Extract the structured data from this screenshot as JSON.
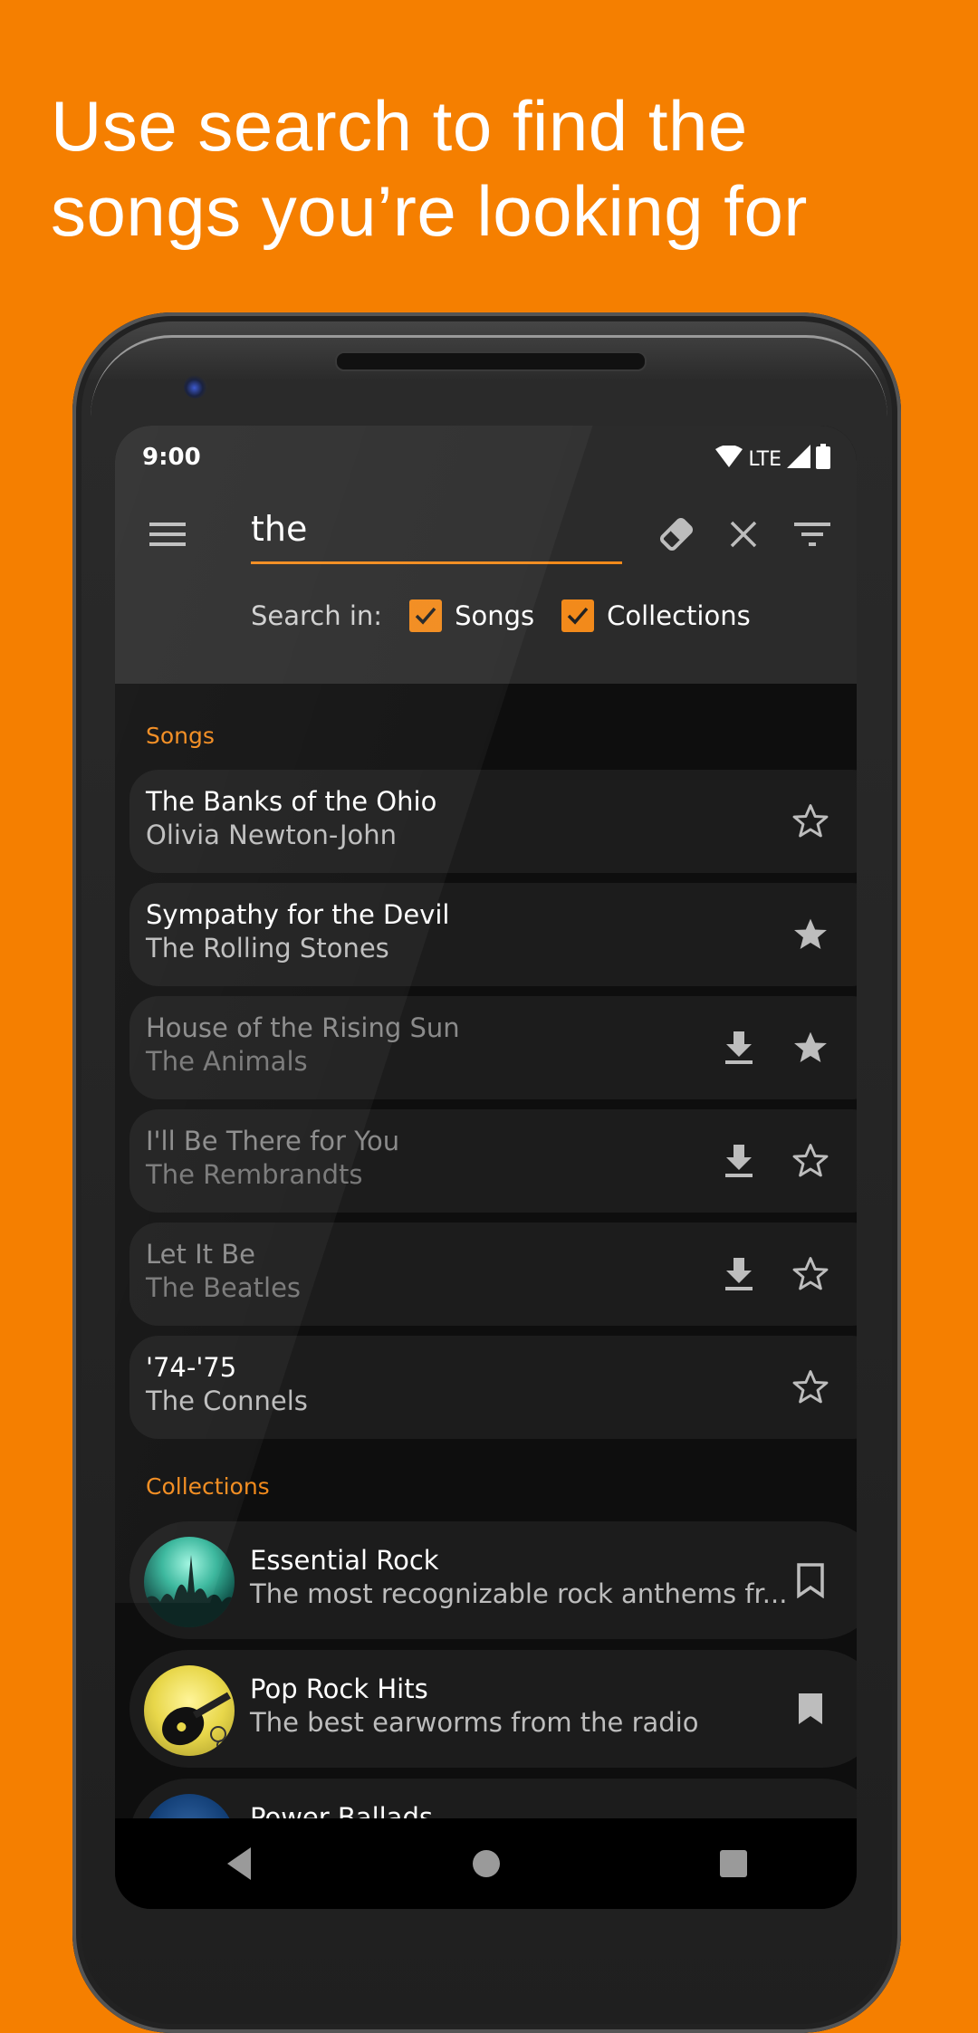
{
  "headline": {
    "line1": "Use search to find the",
    "line2": "songs you’re looking for"
  },
  "colors": {
    "background": "#F57F00",
    "accent": "#F28A1B",
    "appbar": "#2B2B2B",
    "row": "#1C1C1C"
  },
  "status_bar": {
    "time": "9:00",
    "network": "LTE",
    "icons": [
      "wifi-icon",
      "signal-icon",
      "battery-icon"
    ]
  },
  "toolbar": {
    "menu_icon": "hamburger-menu-icon",
    "search_value": "the",
    "search_placeholder": "",
    "clear_text_icon": "eraser-icon",
    "close_icon": "close-icon",
    "filter_icon": "filter-icon"
  },
  "search_in": {
    "label": "Search in:",
    "options": [
      {
        "label": "Songs",
        "checked": true
      },
      {
        "label": "Collections",
        "checked": true
      }
    ]
  },
  "songs": {
    "section_label": "Songs",
    "items": [
      {
        "title": "The Banks of the Ohio",
        "artist": "Olivia Newton-John",
        "available": true,
        "download": false,
        "favorite": false
      },
      {
        "title": "Sympathy for the Devil",
        "artist": "The Rolling Stones",
        "available": true,
        "download": false,
        "favorite": true
      },
      {
        "title": "House of the Rising Sun",
        "artist": "The Animals",
        "available": false,
        "download": true,
        "favorite": true
      },
      {
        "title": "I'll Be There for You",
        "artist": "The Rembrandts",
        "available": false,
        "download": true,
        "favorite": false
      },
      {
        "title": "Let It Be",
        "artist": "The Beatles",
        "available": false,
        "download": true,
        "favorite": false
      },
      {
        "title": "'74-'75",
        "artist": "The Connels",
        "available": true,
        "download": false,
        "favorite": false
      }
    ]
  },
  "collections": {
    "section_label": "Collections",
    "items": [
      {
        "title": "Essential Rock",
        "description": "The most recognizable rock anthems fr...",
        "bookmarked": false,
        "art": "concert-crowd-art"
      },
      {
        "title": "Pop Rock Hits",
        "description": "The best earworms from the radio",
        "bookmarked": true,
        "art": "guitar-art"
      },
      {
        "title": "Power Ballads",
        "description": "",
        "bookmarked": false,
        "art": "candle-art"
      }
    ]
  },
  "navigation_bar": {
    "back": "back-icon",
    "home": "home-icon",
    "recents": "recents-icon"
  }
}
